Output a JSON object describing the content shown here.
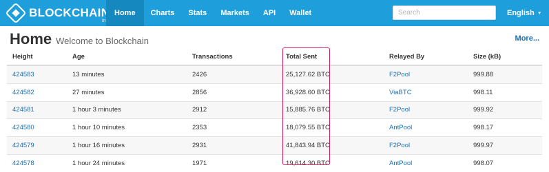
{
  "brand": {
    "name": "BLOCKCHAIN",
    "sub": "info"
  },
  "nav": [
    "Home",
    "Charts",
    "Stats",
    "Markets",
    "API",
    "Wallet"
  ],
  "search": {
    "placeholder": "Search"
  },
  "language": "English",
  "page": {
    "title": "Home",
    "subtitle": "Welcome to Blockchain",
    "more": "More..."
  },
  "table": {
    "headers": [
      "Height",
      "Age",
      "Transactions",
      "Total Sent",
      "Relayed By",
      "Size (kB)"
    ],
    "rows": [
      [
        "424583",
        "13 minutes",
        "2426",
        "25,127.62 BTC",
        "F2Pool",
        "999.88"
      ],
      [
        "424582",
        "27 minutes",
        "2856",
        "36,928.60 BTC",
        "ViaBTC",
        "998.11"
      ],
      [
        "424581",
        "1 hour 3 minutes",
        "2912",
        "15,885.76 BTC",
        "F2Pool",
        "999.92"
      ],
      [
        "424580",
        "1 hour 10 minutes",
        "2353",
        "18,079.55 BTC",
        "AntPool",
        "998.17"
      ],
      [
        "424579",
        "1 hour 16 minutes",
        "2931",
        "41,843.94 BTC",
        "F2Pool",
        "999.97"
      ],
      [
        "424578",
        "1 hour 24 minutes",
        "1971",
        "19,614.30 BTC",
        "AntPool",
        "998.07"
      ]
    ]
  },
  "colors": {
    "navbar": "#1e9fdb",
    "link": "#1a6fb5",
    "highlight": "#d8245c"
  }
}
